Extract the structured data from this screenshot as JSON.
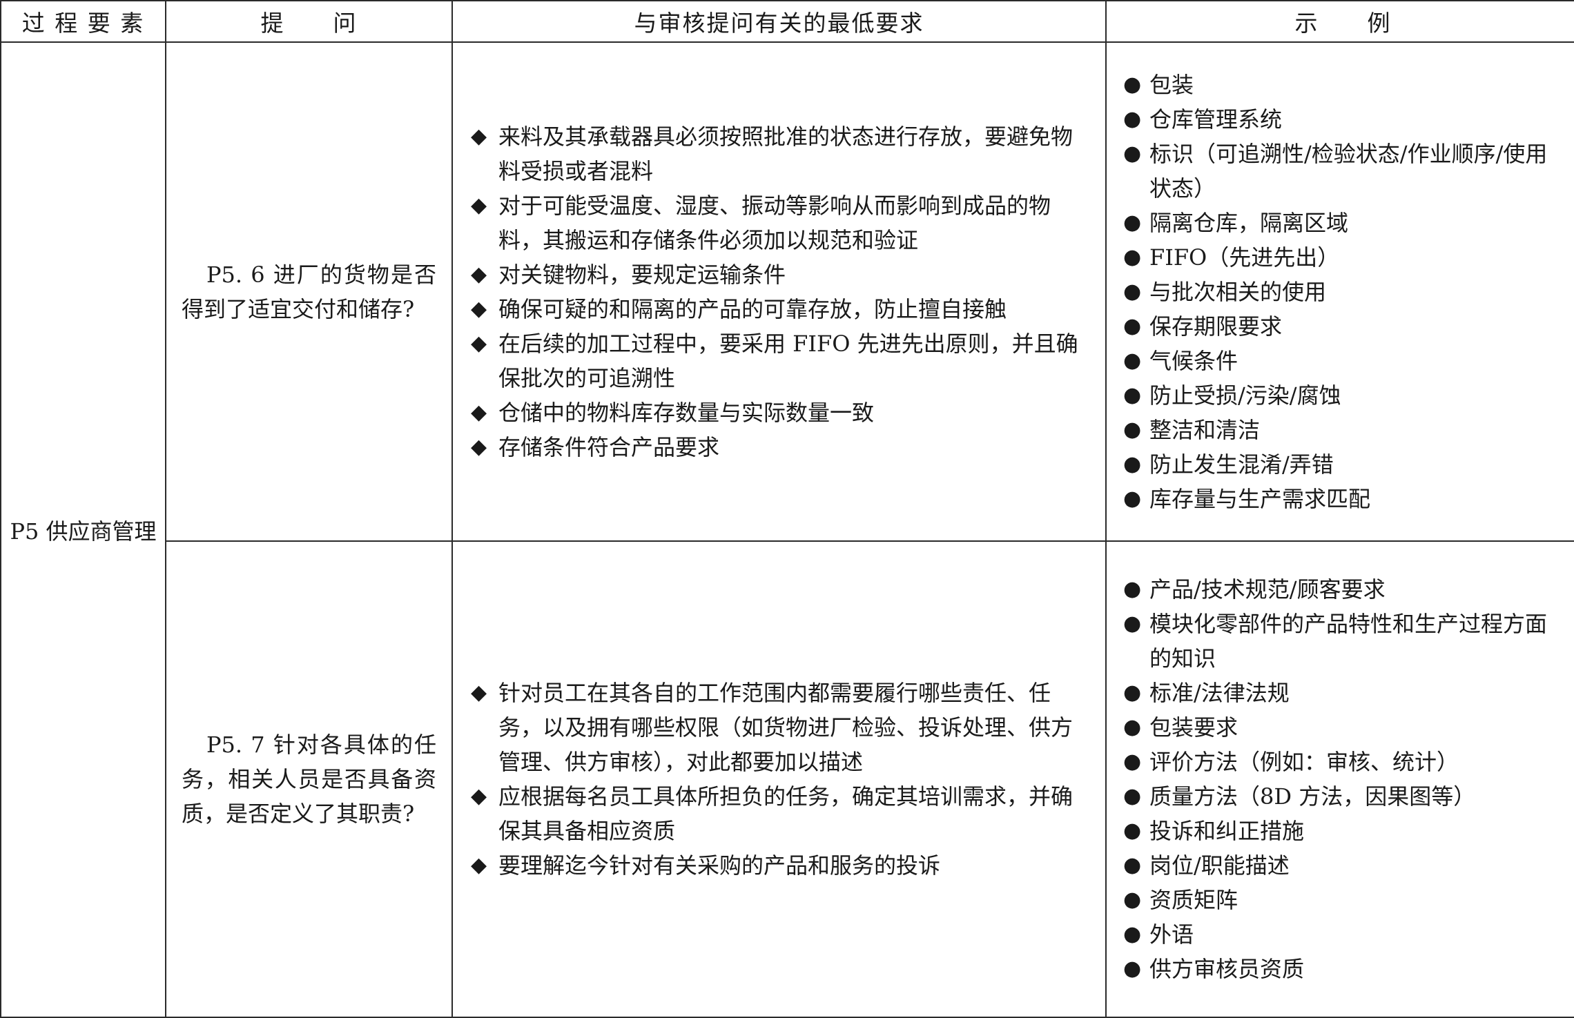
{
  "header": {
    "col1": "过 程 要 素",
    "col2": "提　　问",
    "col3": "与审核提问有关的最低要求",
    "col4": "示　　例"
  },
  "process_element": "P5 供应商管理",
  "rows": [
    {
      "question": "P5. 6 进厂的货物是否得到了适宜交付和储存?",
      "requirements": [
        "来料及其承载器具必须按照批准的状态进行存放，要避免物料受损或者混料",
        "对于可能受温度、湿度、振动等影响从而影响到成品的物料，其搬运和存储条件必须加以规范和验证",
        "对关键物料，要规定运输条件",
        "确保可疑的和隔离的产品的可靠存放，防止擅自接触",
        "在后续的加工过程中，要采用 FIFO 先进先出原则，并且确保批次的可追溯性",
        "仓储中的物料库存数量与实际数量一致",
        "存储条件符合产品要求"
      ],
      "examples": [
        "包装",
        "仓库管理系统",
        "标识（可追溯性/检验状态/作业顺序/使用状态）",
        "隔离仓库，隔离区域",
        "FIFO（先进先出）",
        "与批次相关的使用",
        "保存期限要求",
        "气候条件",
        "防止受损/污染/腐蚀",
        "整洁和清洁",
        "防止发生混淆/弄错",
        "库存量与生产需求匹配"
      ]
    },
    {
      "question": "P5. 7 针对各具体的任务，相关人员是否具备资质，是否定义了其职责?",
      "requirements": [
        "针对员工在其各自的工作范围内都需要履行哪些责任、任务，以及拥有哪些权限（如货物进厂检验、投诉处理、供方管理、供方审核），对此都要加以描述",
        "应根据每名员工具体所担负的任务，确定其培训需求，并确保其具备相应资质",
        "要理解迄今针对有关采购的产品和服务的投诉"
      ],
      "examples": [
        "产品/技术规范/顾客要求",
        "模块化零部件的产品特性和生产过程方面的知识",
        "标准/法律法规",
        "包装要求",
        "评价方法（例如：审核、统计）",
        "质量方法（8D 方法，因果图等）",
        "投诉和纠正措施",
        "岗位/职能描述",
        "资质矩阵",
        "外语",
        "供方审核员资质"
      ]
    }
  ],
  "markers": {
    "requirement": "◆",
    "example": "●"
  }
}
